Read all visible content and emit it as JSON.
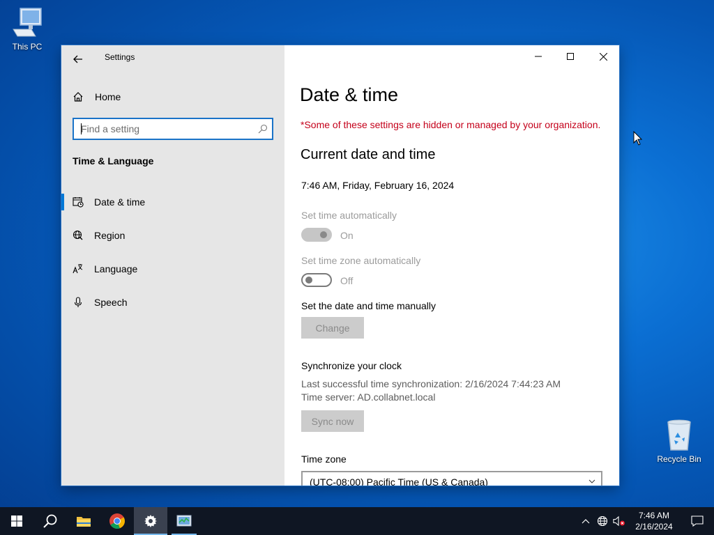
{
  "desktop": {
    "this_pc_label": "This PC",
    "recycle_bin_label": "Recycle Bin"
  },
  "window": {
    "app_title": "Settings",
    "accent_color": "#0078d7"
  },
  "nav": {
    "home_label": "Home",
    "search_placeholder": "Find a setting",
    "section_title": "Time & Language",
    "items": [
      {
        "label": "Date & time",
        "icon": "calendar-clock-icon",
        "active": true
      },
      {
        "label": "Region",
        "icon": "globe-icon",
        "active": false
      },
      {
        "label": "Language",
        "icon": "language-icon",
        "active": false
      },
      {
        "label": "Speech",
        "icon": "microphone-icon",
        "active": false
      }
    ]
  },
  "content": {
    "title": "Date & time",
    "managed_notice": "*Some of these settings are hidden or managed by your organization.",
    "current_heading": "Current date and time",
    "current_datetime": "7:46 AM, Friday, February 16, 2024",
    "set_time_auto_label": "Set time automatically",
    "set_time_auto_state": "On",
    "set_tz_auto_label": "Set time zone automatically",
    "set_tz_auto_state": "Off",
    "manual_label": "Set the date and time manually",
    "change_button": "Change",
    "sync_heading": "Synchronize your clock",
    "last_sync": "Last successful time synchronization: 2/16/2024 7:44:23 AM",
    "time_server": "Time server: AD.collabnet.local",
    "sync_button": "Sync now",
    "timezone_label": "Time zone",
    "timezone_value": "(UTC-08:00) Pacific Time (US & Canada)",
    "warning_color": "#c4001a"
  },
  "taskbar": {
    "clock_time": "7:46 AM",
    "clock_date": "2/16/2024"
  }
}
